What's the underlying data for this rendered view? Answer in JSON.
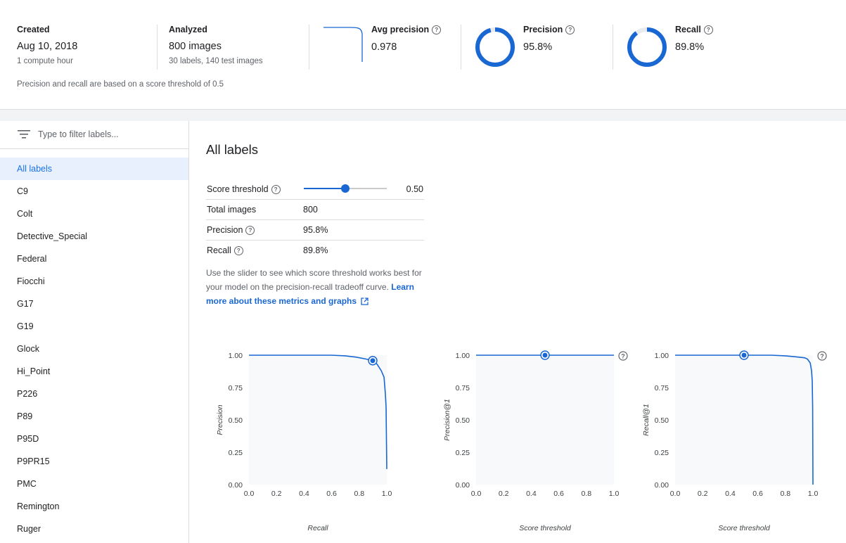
{
  "summary": {
    "created": {
      "title": "Created",
      "value": "Aug 10, 2018",
      "sub": "1 compute hour"
    },
    "analyzed": {
      "title": "Analyzed",
      "value": "800 images",
      "sub": "30 labels, 140 test images"
    },
    "avg_precision": {
      "title": "Avg precision",
      "value": "0.978"
    },
    "precision": {
      "title": "Precision",
      "value": "95.8%",
      "fraction": 0.958
    },
    "recall": {
      "title": "Recall",
      "value": "89.8%",
      "fraction": 0.898
    },
    "threshold_note": "Precision and recall are based on a score threshold of 0.5"
  },
  "filter": {
    "placeholder": "Type to filter labels..."
  },
  "labels": [
    "All labels",
    "C9",
    "Colt",
    "Detective_Special",
    "Federal",
    "Fiocchi",
    "G17",
    "G19",
    "Glock",
    "Hi_Point",
    "P226",
    "P89",
    "P95D",
    "P9PR15",
    "PMC",
    "Remington",
    "Ruger"
  ],
  "selected_label": "All labels",
  "main": {
    "title": "All labels",
    "score_threshold_label": "Score threshold",
    "score_threshold": 0.5,
    "score_threshold_text": "0.50",
    "total_images_label": "Total images",
    "total_images": "800",
    "precision_label": "Precision",
    "precision": "95.8%",
    "recall_label": "Recall",
    "recall": "89.8%",
    "explain_text": "Use the slider to see which score threshold works best for your model on the precision-recall tradeoff curve. ",
    "learn_more": "Learn more about these metrics and graphs"
  },
  "colors": {
    "accent": "#1967d2",
    "ring_track": "#e8eaed",
    "plot_bg": "#f8f9fa"
  },
  "chart_data": [
    {
      "type": "line",
      "xlabel": "Recall",
      "ylabel": "Precision",
      "xlim": [
        0,
        1
      ],
      "ylim": [
        0,
        1
      ],
      "x_ticks": [
        "0.0",
        "0.2",
        "0.4",
        "0.6",
        "0.8",
        "1.0"
      ],
      "y_ticks": [
        "0.00",
        "0.25",
        "0.50",
        "0.75",
        "1.00"
      ],
      "x": [
        0.0,
        0.4,
        0.6,
        0.7,
        0.78,
        0.85,
        0.898,
        0.93,
        0.96,
        0.98,
        0.99,
        0.995,
        1.0
      ],
      "y": [
        1.0,
        1.0,
        1.0,
        0.995,
        0.985,
        0.97,
        0.958,
        0.93,
        0.88,
        0.83,
        0.7,
        0.6,
        0.12
      ],
      "marker": {
        "x": 0.898,
        "y": 0.958
      },
      "help": false
    },
    {
      "type": "line",
      "xlabel": "Score threshold",
      "ylabel": "Precision@1",
      "xlim": [
        0,
        1
      ],
      "ylim": [
        0,
        1
      ],
      "x_ticks": [
        "0.0",
        "0.2",
        "0.4",
        "0.6",
        "0.8",
        "1.0"
      ],
      "y_ticks": [
        "0.00",
        "0.25",
        "0.50",
        "0.75",
        "1.00"
      ],
      "x": [
        0.0,
        1.0
      ],
      "y": [
        1.0,
        1.0
      ],
      "marker": {
        "x": 0.5,
        "y": 1.0
      },
      "help": true
    },
    {
      "type": "line",
      "xlabel": "Score threshold",
      "ylabel": "Recall@1",
      "xlim": [
        0,
        1
      ],
      "ylim": [
        0,
        1
      ],
      "x_ticks": [
        "0.0",
        "0.2",
        "0.4",
        "0.6",
        "0.8",
        "1.0"
      ],
      "y_ticks": [
        "0.00",
        "0.25",
        "0.50",
        "0.75",
        "1.00"
      ],
      "x": [
        0.0,
        0.5,
        0.7,
        0.8,
        0.85,
        0.9,
        0.94,
        0.96,
        0.98,
        0.99,
        0.995,
        0.998,
        1.0
      ],
      "y": [
        1.0,
        1.0,
        1.0,
        0.995,
        0.99,
        0.985,
        0.98,
        0.97,
        0.94,
        0.88,
        0.8,
        0.6,
        0.0
      ],
      "marker": {
        "x": 0.5,
        "y": 1.0
      },
      "help": true
    }
  ]
}
